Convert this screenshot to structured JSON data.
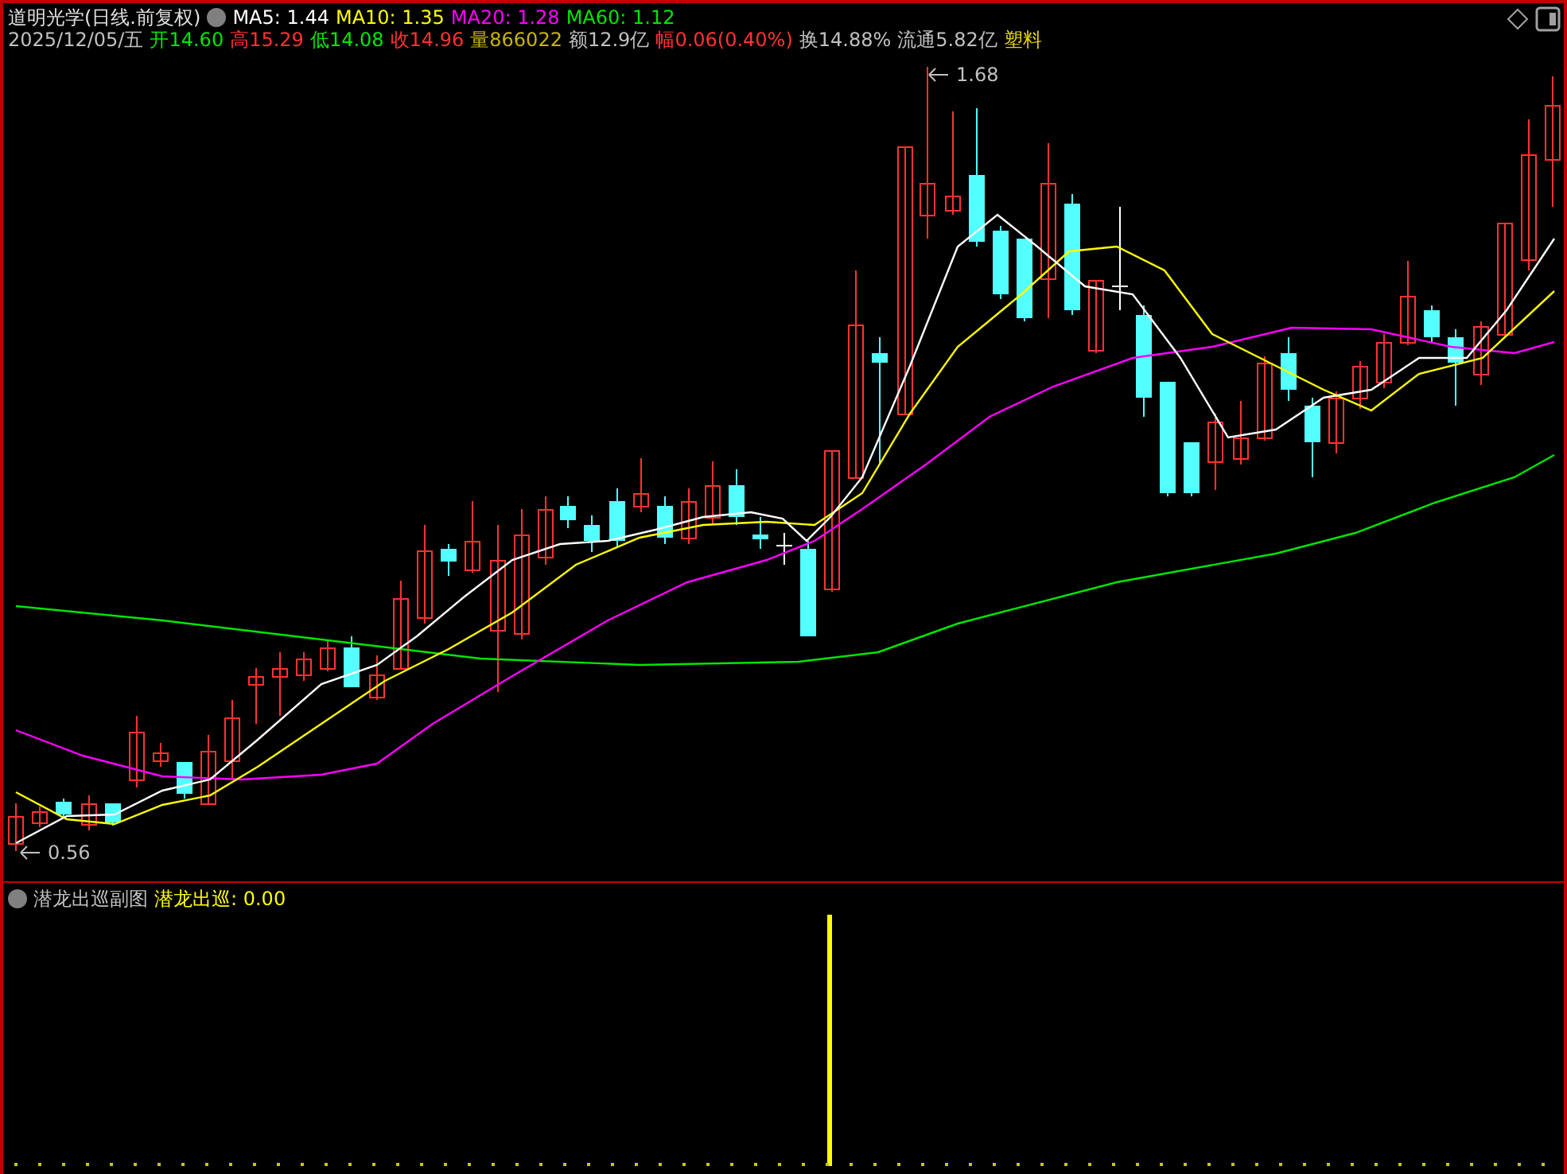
{
  "header": {
    "title": "道明光学(日线.前复权)",
    "indicators": [
      {
        "text": "MA5: 1.44",
        "color": "#ffffff"
      },
      {
        "text": "MA10: 1.35",
        "color": "#ffff00"
      },
      {
        "text": "MA20: 1.28",
        "color": "#ff00ff"
      },
      {
        "text": "MA60: 1.12",
        "color": "#00e600"
      }
    ],
    "date": "2025/12/05/五",
    "quotes": [
      {
        "text": "开14.60",
        "color": "#00e600"
      },
      {
        "text": "高15.29",
        "color": "#ff3232"
      },
      {
        "text": "低14.08",
        "color": "#00e600"
      },
      {
        "text": "收14.96",
        "color": "#ff3232"
      },
      {
        "text": "量866022",
        "color": "#c8b400"
      },
      {
        "text": "额12.9亿",
        "color": "#c0c0c0"
      },
      {
        "text": "幅0.06(0.40%)",
        "color": "#ff3232"
      },
      {
        "text": "换14.88%",
        "color": "#c0c0c0"
      },
      {
        "text": "流通5.82亿",
        "color": "#c0c0c0"
      },
      {
        "text": "塑料",
        "color": "#e6d200"
      }
    ]
  },
  "chart_annotations": [
    {
      "kind": "high",
      "text": "1.68"
    },
    {
      "kind": "low",
      "text": "0.56"
    }
  ],
  "sub_panel": {
    "title": "潜龙出巡副图",
    "indicator": "潜龙出巡: 0.00"
  }
}
